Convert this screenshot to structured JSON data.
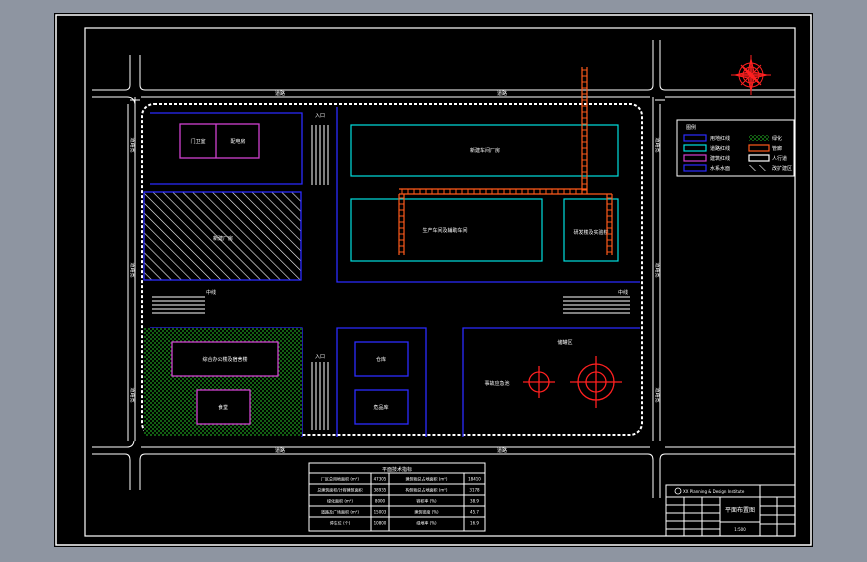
{
  "background": {
    "app_bg": "#8e95a1",
    "canvas": "#000000",
    "frame_line": "#ffffff"
  },
  "colors": {
    "blue_line": "#2b2bff",
    "cyan_line": "#00e0e0",
    "magenta_line": "#d040d0",
    "orange_line": "#ff5a1a",
    "red_line": "#ff2020",
    "green_fill": "#1fa41f",
    "road_line": "#ffffff"
  },
  "legend": {
    "title": "图例",
    "left_items": [
      "用地红线",
      "道路红线",
      "建筑红线",
      "水系水面"
    ],
    "right_items": [
      "绿化",
      "管廊",
      "人行道",
      "改扩建区"
    ]
  },
  "roads": {
    "top": "道路",
    "bottom": "道路",
    "left": "道路宽",
    "right": "道路宽",
    "mid_left": "中线",
    "mid_right": "中线",
    "entrance_top": "入口",
    "entrance_bottom": "入口"
  },
  "buildings": {
    "gate_a": "门卫室",
    "gate_b": "配电房",
    "hatched": "新建厂房",
    "top_right": "新建车间厂房",
    "mid": "生产车间及辅助车间",
    "right_small": "研发楼及实验楼",
    "green_bldg": "综合办公楼及宿舍楼",
    "small_office": "食堂",
    "block_a": "仓库",
    "block_b": "危品库",
    "tank_area_title": "储罐区",
    "tank_label": "事故应急池"
  },
  "table": {
    "title": "平面技术指标",
    "rows": [
      [
        "厂区总用地面积 (m²)",
        "47305",
        "建筑物总占地面积 (m²)",
        "18410"
      ],
      [
        "总建筑面积/计容建筑面积",
        "38935",
        "构筑物总占地面积 (m²)",
        "3178"
      ],
      [
        "绿化面积 (m²)",
        "8000",
        "容积率 (%)",
        "38.9"
      ],
      [
        "道路及广场面积 (m²)",
        "15003",
        "建筑密度 (%)",
        "45.7"
      ],
      [
        "停车位 (个)",
        "10800",
        "绿地率 (%)",
        "16.9"
      ]
    ]
  },
  "title_block": {
    "company": "XX Planning & Design Institute",
    "drawing_title": "平面布置图",
    "scale": "1:500"
  }
}
